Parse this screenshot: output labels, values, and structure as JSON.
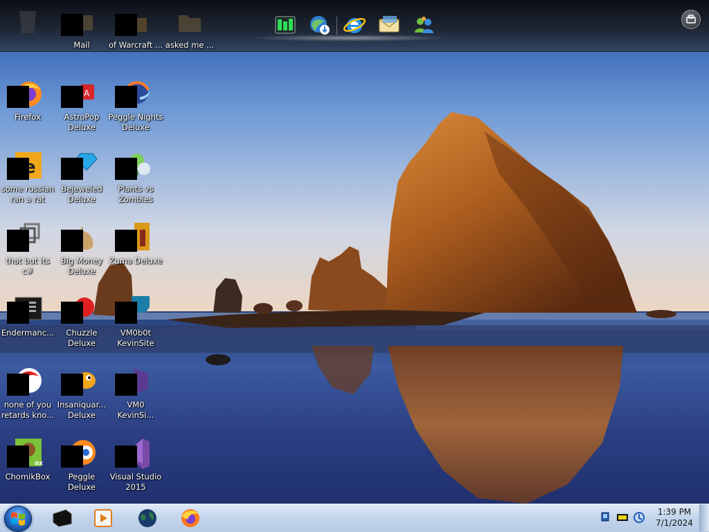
{
  "desktop": {
    "wallpaper": "sea-stack-sunset",
    "icons": [
      {
        "label": "",
        "icon": "recycle-bin-icon"
      },
      {
        "label": "Mail",
        "icon": "mail-icon"
      },
      {
        "label": "of Warcraft ...",
        "icon": "folder-icon"
      },
      {
        "label": "asked me ...",
        "icon": "folder-icon"
      },
      {
        "label": "Firefox",
        "icon": "firefox-icon"
      },
      {
        "label": "AstroPop\nDeluxe",
        "icon": "astropop-icon"
      },
      {
        "label": "Peggle Nights\nDeluxe",
        "icon": "peggle-nights-icon"
      },
      {
        "label": "some russian\nran a rat",
        "icon": "app-icon"
      },
      {
        "label": "Bejeweled\nDeluxe",
        "icon": "bejeweled-icon"
      },
      {
        "label": "Plants vs\nZombies",
        "icon": "plants-vs-zombies-icon"
      },
      {
        "label": "that but its c#",
        "icon": "shortcut-icon"
      },
      {
        "label": "Big Money\nDeluxe",
        "icon": "money-bag-icon"
      },
      {
        "label": "Zuma Deluxe",
        "icon": "zuma-icon"
      },
      {
        "label": "Endermanc...",
        "icon": "terminal-icon"
      },
      {
        "label": "Chuzzle\nDeluxe",
        "icon": "chuzzle-icon"
      },
      {
        "label": "VM0b0t\nKevinSite",
        "icon": "vm-icon"
      },
      {
        "label": "none of you\nretards kno...",
        "icon": "app-icon"
      },
      {
        "label": "Insaniquar...\nDeluxe",
        "icon": "insaniquarium-icon"
      },
      {
        "label": "VM0\nKevinSi...",
        "icon": "vm-icon"
      },
      {
        "label": "ChomikBox",
        "icon": "chomikbox-icon"
      },
      {
        "label": "Peggle Deluxe",
        "icon": "peggle-icon"
      },
      {
        "label": "Visual Studio\n2015",
        "icon": "visual-studio-icon"
      }
    ]
  },
  "dock": {
    "items": [
      {
        "icon": "task-manager-icon"
      },
      {
        "icon": "internet-download-icon"
      },
      {
        "icon": "internet-explorer-icon"
      },
      {
        "icon": "mail-icon"
      },
      {
        "icon": "messenger-icon"
      }
    ],
    "menu_icon": "dock-menu-icon"
  },
  "taskbar": {
    "start_icon": "windows-start-icon",
    "pinned": [
      {
        "icon": "black-box-icon"
      },
      {
        "icon": "media-player-icon"
      },
      {
        "icon": "globe-icon"
      },
      {
        "icon": "firefox-icon"
      }
    ],
    "tray": [
      {
        "icon": "network-icon"
      },
      {
        "icon": "battery-icon"
      },
      {
        "icon": "update-icon"
      }
    ],
    "clock": {
      "time": "1:39 PM",
      "date": "7/1/2024"
    }
  },
  "colors": {
    "taskbar": "#c4d6ec",
    "dock": "#1c2026",
    "sky_top": "#1d4ea6",
    "sky_horizon": "#e8d4c2"
  }
}
